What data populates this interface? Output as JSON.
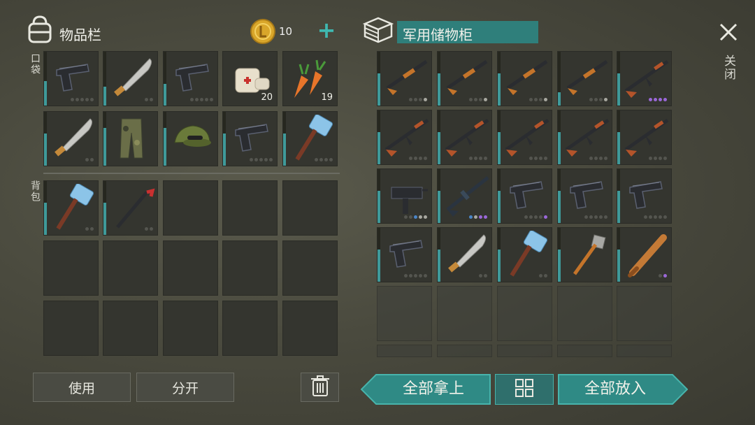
{
  "inventory": {
    "title": "物品栏",
    "coins": "10",
    "add_symbol": "+",
    "pocket_label": "口袋",
    "backpack_label": "背包",
    "pocket_items": [
      {
        "icon": "pistol-icon",
        "durability": 0.45,
        "dots": [
          "off",
          "off",
          "off",
          "off",
          "off"
        ]
      },
      {
        "icon": "machete-icon",
        "durability": 0.35,
        "dots": [
          "off",
          "off"
        ]
      },
      {
        "icon": "pistol-icon",
        "durability": 0.4,
        "dots": [
          "off",
          "off",
          "off",
          "off",
          "off"
        ]
      },
      {
        "icon": "bandage-icon",
        "count": "20"
      },
      {
        "icon": "carrot-icon",
        "count": "19"
      },
      {
        "icon": "machete-icon",
        "durability": 0.6,
        "dots": [
          "off",
          "off"
        ]
      },
      {
        "icon": "camo-pants-icon",
        "durability": 0.7
      },
      {
        "icon": "camo-cap-icon",
        "durability": 0.7
      },
      {
        "icon": "pistol-icon",
        "durability": 0.6,
        "dots": [
          "off",
          "off",
          "off",
          "off",
          "off"
        ]
      },
      {
        "icon": "sledgehammer-icon",
        "durability": 0.6,
        "dots": [
          "off",
          "off",
          "off",
          "off"
        ]
      }
    ],
    "backpack_items": [
      {
        "icon": "sledgehammer-icon",
        "durability": 0.6,
        "dots": [
          "off",
          "off"
        ]
      },
      {
        "icon": "crowbar-icon",
        "durability": 0.6,
        "dots": [
          "off",
          "off"
        ]
      }
    ]
  },
  "storage": {
    "title": "军用储物柜",
    "close_label": "关闭",
    "items": [
      {
        "icon": "shotgun-icon",
        "durability": 0.6,
        "dots": [
          "off",
          "off",
          "off",
          "on"
        ]
      },
      {
        "icon": "shotgun-icon",
        "durability": 0.6,
        "dots": [
          "off",
          "off",
          "off",
          "on"
        ]
      },
      {
        "icon": "shotgun-icon",
        "durability": 0.6,
        "dots": [
          "off",
          "off",
          "off",
          "on"
        ]
      },
      {
        "icon": "shotgun-icon",
        "durability": 0.25,
        "dots": [
          "off",
          "off",
          "off",
          "on"
        ]
      },
      {
        "icon": "ak-rifle-icon",
        "durability": 0.6,
        "dots": [
          "purple",
          "purple",
          "purple",
          "purple"
        ]
      },
      {
        "icon": "ak-rifle-icon",
        "durability": 0.6,
        "dots": [
          "off",
          "off",
          "off",
          "off"
        ]
      },
      {
        "icon": "ak-rifle-icon",
        "durability": 0.6,
        "dots": [
          "off",
          "off",
          "off",
          "off"
        ]
      },
      {
        "icon": "ak-rifle-icon",
        "durability": 0.6,
        "dots": [
          "off",
          "off",
          "off",
          "off"
        ]
      },
      {
        "icon": "ak-rifle-icon",
        "durability": 0.6,
        "dots": [
          "off",
          "off",
          "off",
          "off"
        ]
      },
      {
        "icon": "ak-rifle-icon",
        "durability": 0.6,
        "dots": [
          "off",
          "off",
          "off",
          "off"
        ]
      },
      {
        "icon": "uzi-icon",
        "durability": 0.6,
        "dots": [
          "off",
          "off",
          "blue",
          "on",
          "on"
        ]
      },
      {
        "icon": "m4-rifle-icon",
        "durability": 0.6,
        "dots": [
          "blue",
          "on",
          "purple",
          "purple"
        ]
      },
      {
        "icon": "pistol-icon",
        "durability": 0.6,
        "dots": [
          "off",
          "off",
          "off",
          "off",
          "purple"
        ]
      },
      {
        "icon": "pistol-icon",
        "durability": 0.6,
        "dots": [
          "off",
          "off",
          "off",
          "off",
          "off"
        ]
      },
      {
        "icon": "pistol-icon",
        "durability": 0.6,
        "dots": [
          "off",
          "off",
          "off",
          "off",
          "off"
        ]
      },
      {
        "icon": "pistol-icon",
        "durability": 0.6,
        "dots": [
          "off",
          "off",
          "off",
          "off",
          "off"
        ]
      },
      {
        "icon": "machete-icon",
        "durability": 0.6,
        "dots": [
          "off",
          "off"
        ]
      },
      {
        "icon": "sledgehammer-icon",
        "durability": 0.6,
        "dots": [
          "off",
          "off"
        ]
      },
      {
        "icon": "shovel-icon",
        "durability": 0.6
      },
      {
        "icon": "baseball-bat-icon",
        "durability": 0.6,
        "dots": [
          "off",
          "purple"
        ]
      }
    ]
  },
  "actions": {
    "use_label": "使用",
    "split_label": "分开",
    "take_all_label": "全部拿上",
    "put_all_label": "全部放入"
  },
  "colors": {
    "teal": "#2f8a85",
    "durability": "#3f9a9a"
  }
}
